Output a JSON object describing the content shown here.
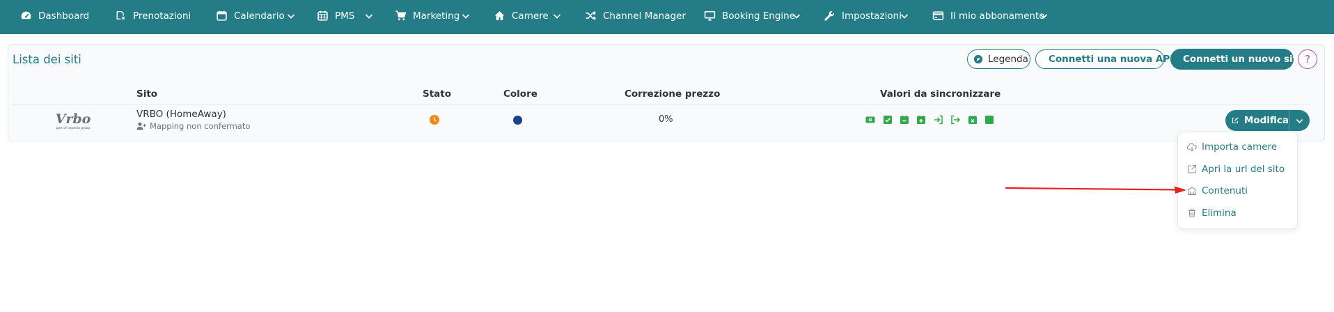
{
  "nav": {
    "dashboard": "Dashboard",
    "prenotazioni": "Prenotazioni",
    "calendario": "Calendario",
    "pms": "PMS",
    "marketing": "Marketing",
    "camere": "Camere",
    "channel_manager": "Channel Manager",
    "booking_engine": "Booking Engine",
    "impostazioni": "Impostazioni",
    "abbonamento": "Il mio abbonamento",
    "bg_color": "#237c86"
  },
  "page": {
    "title": "Lista dei siti",
    "buttons": {
      "legenda": "Legenda",
      "connetti_api": "Connetti una nuova API",
      "connetti_sito": "Connetti un nuovo sito",
      "help": "?"
    }
  },
  "table": {
    "headers": {
      "sito": "Sito",
      "stato": "Stato",
      "colore": "Colore",
      "correzione": "Correzione prezzo",
      "valori": "Valori da sincronizzare"
    },
    "rows": [
      {
        "logo_text": "Vrbo",
        "logo_subtext": "part of expedia group",
        "name": "VRBO (HomeAway)",
        "mapping": "Mapping non confermato",
        "stato_color": "#f08a1c",
        "colore": "#17428e",
        "correzione": "0%",
        "sync_icons": [
          "price-icon",
          "availability-check-icon",
          "calendar-minus-icon",
          "calendar-plus-icon",
          "checkin-icon",
          "checkout-icon",
          "calendar-x-icon",
          "square-icon"
        ],
        "action": "Modifica"
      }
    ]
  },
  "dropdown": {
    "items": [
      "Importa camere",
      "Apri la url del sito",
      "Contenuti",
      "Elimina"
    ]
  },
  "colors": {
    "accent": "#237c86",
    "sync_green": "#2eaa4e",
    "help_purple": "#b44ca6",
    "arrow_red": "#e8231b"
  }
}
